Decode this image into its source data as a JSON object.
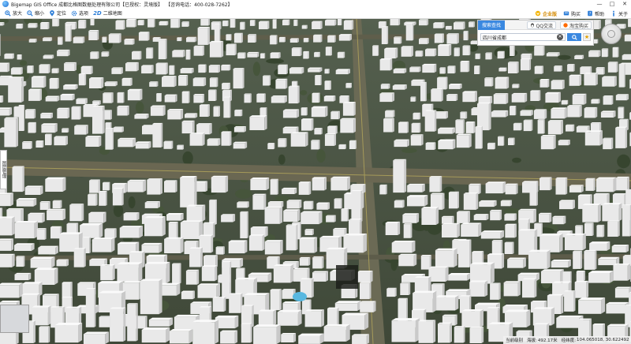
{
  "window": {
    "title": "Bigemap GIS Office 成都比格图数据处理有限公司【已授权：灵境版】",
    "phone": "【咨询电话：400-028-7262】",
    "controls": [
      "—",
      "□",
      "✕"
    ]
  },
  "toolbar": {
    "left": [
      {
        "label": "放大",
        "icon": "zoom-in-icon"
      },
      {
        "label": "缩小",
        "icon": "zoom-out-icon"
      },
      {
        "label": "定位",
        "icon": "location-pin-icon"
      },
      {
        "label": "选项",
        "icon": "gear-icon"
      },
      {
        "label": "二维地图",
        "icon": "2d-map-icon",
        "prefix": "2D"
      }
    ],
    "right": [
      {
        "label": "企业版",
        "icon": "vip-badge-icon"
      },
      {
        "label": "购买",
        "icon": "cart-icon"
      },
      {
        "label": "帮助",
        "icon": "help-book-icon"
      },
      {
        "label": "关于",
        "icon": "info-icon"
      }
    ]
  },
  "search_panel": {
    "active_tab": "搜索查找",
    "tabs": [
      {
        "label": "QQ交流",
        "icon": "qq-icon"
      },
      {
        "label": "淘宝购买",
        "icon": "taobao-icon"
      }
    ],
    "input_value": "四川省成都",
    "search_icon": "search-icon",
    "favorite_icon": "star-icon"
  },
  "side_tab": {
    "label": "图层管理"
  },
  "status": {
    "level_label": "当前级别",
    "altitude_label": "海拔:",
    "altitude": "492.17米",
    "coords_label": "经纬度:",
    "coords": "104.065018, 30.622492"
  },
  "colors": {
    "accent": "#3a88e0",
    "buildings": "#eeeeee",
    "road": "#6b6a55"
  }
}
